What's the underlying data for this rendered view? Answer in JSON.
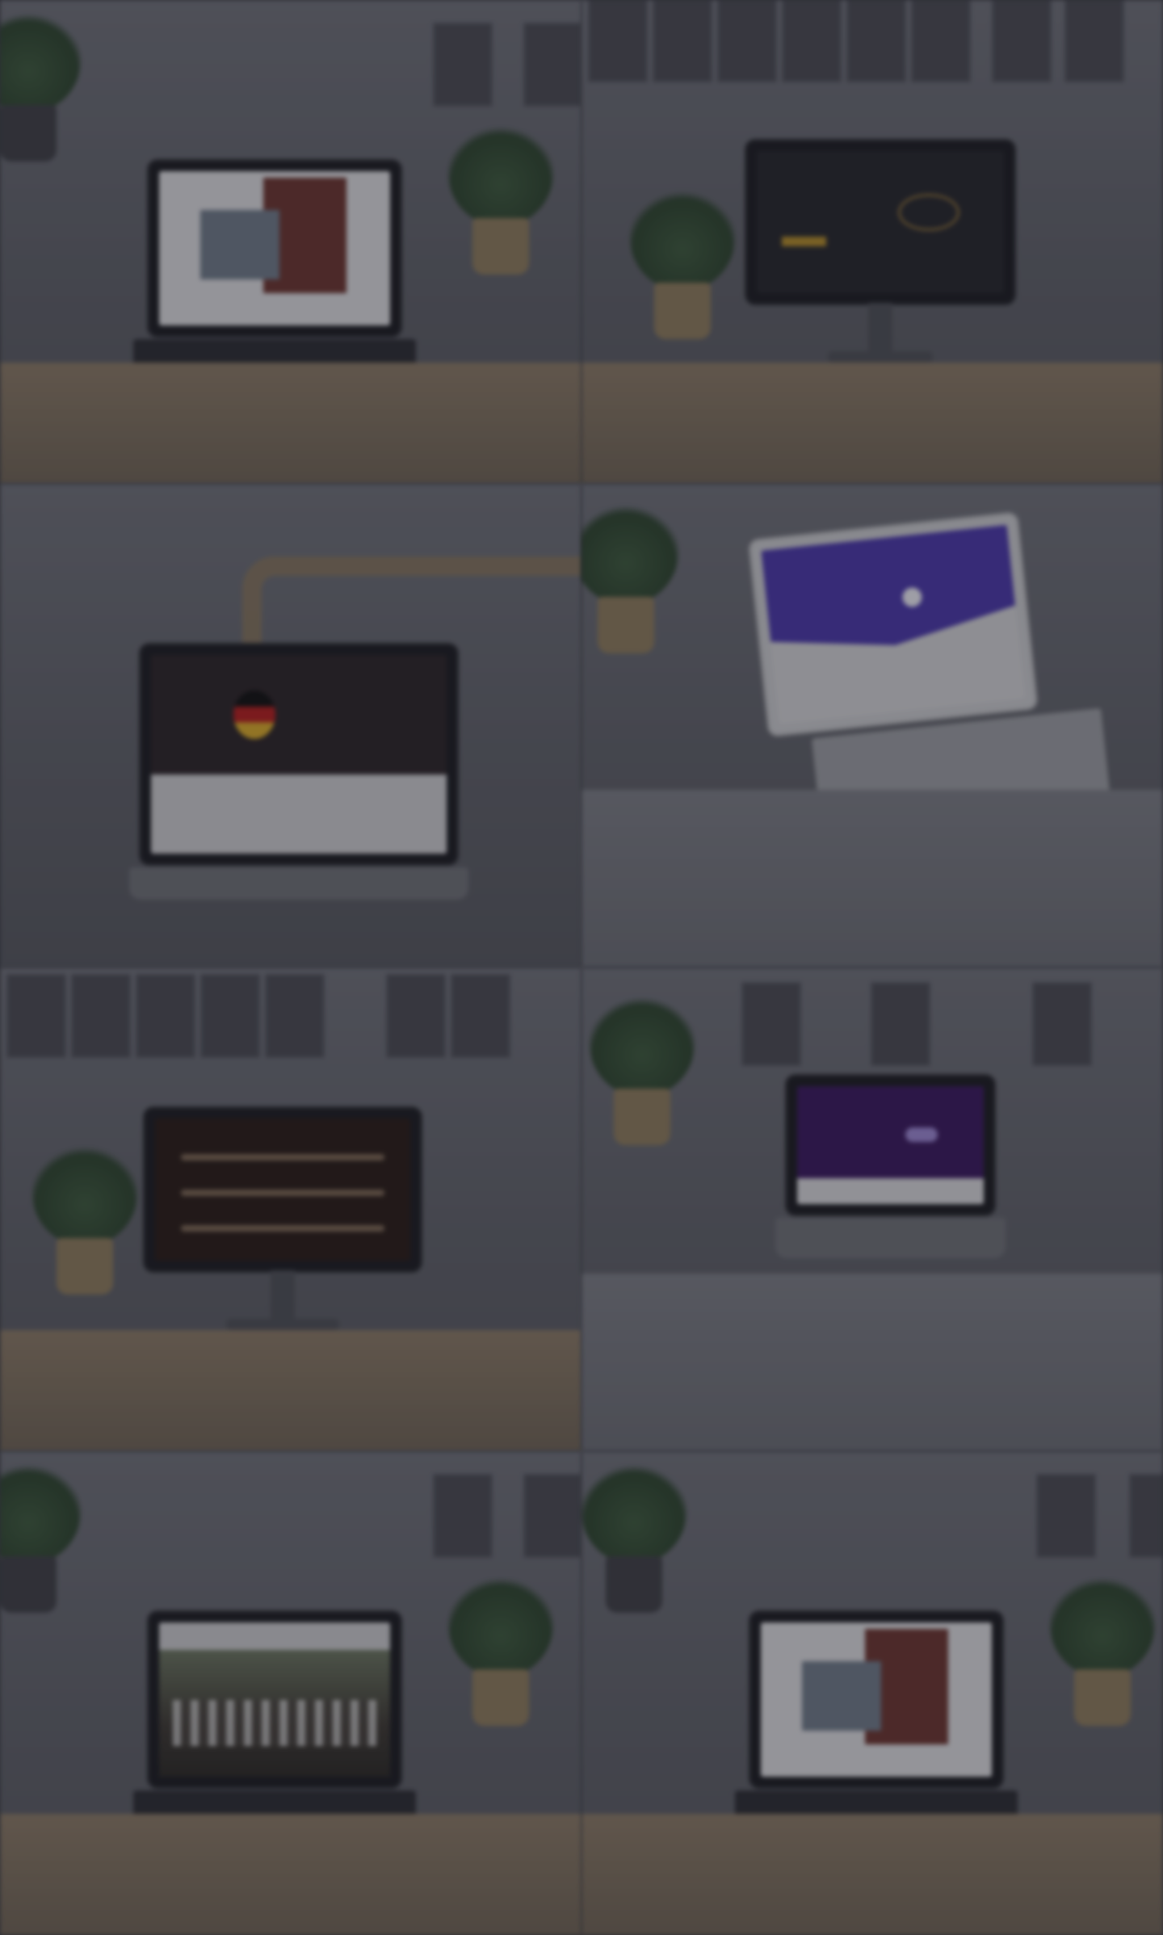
{
  "gallery": {
    "tiles": [
      {
        "scene": "desk-laptop-white-site"
      },
      {
        "scene": "desk-monitor-dark-site"
      },
      {
        "scene": "chair-laptop-red-site"
      },
      {
        "scene": "table-laptop-purple-site"
      },
      {
        "scene": "desk-monitor-brown-site"
      },
      {
        "scene": "table-laptop-violet-site"
      },
      {
        "scene": "desk-laptop-crowd-site"
      },
      {
        "scene": "desk-laptop-white-site"
      }
    ]
  },
  "colors": {
    "background": "#3b3d44",
    "overlay": "rgba(20,20,28,0.35)"
  }
}
